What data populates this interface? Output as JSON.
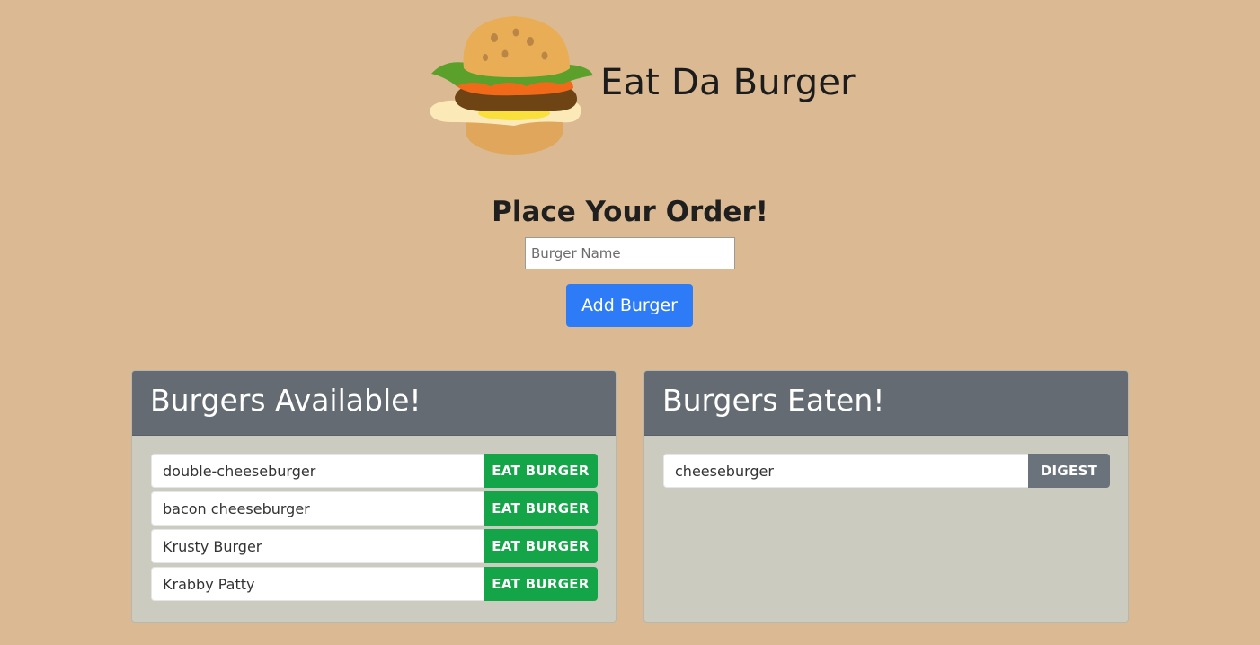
{
  "header": {
    "title": "Eat Da Burger",
    "logo_icon": "burger-icon"
  },
  "order": {
    "title": "Place Your Order!",
    "input_placeholder": "Burger Name",
    "input_value": "",
    "add_button_label": "Add Burger"
  },
  "available": {
    "title": "Burgers Available!",
    "button_label": "EAT BURGER",
    "items": [
      "double-cheeseburger",
      "bacon cheeseburger",
      "Krusty Burger",
      "Krabby Patty"
    ]
  },
  "eaten": {
    "title": "Burgers Eaten!",
    "button_label": "DIGEST",
    "items": [
      "cheeseburger"
    ]
  },
  "colors": {
    "background": "#dbba93",
    "add_button": "#2d7bf7",
    "eat_button": "#13a548",
    "digest_button": "#6a737c",
    "card_header": "#646b72",
    "card_body": "#cbcbc0"
  }
}
